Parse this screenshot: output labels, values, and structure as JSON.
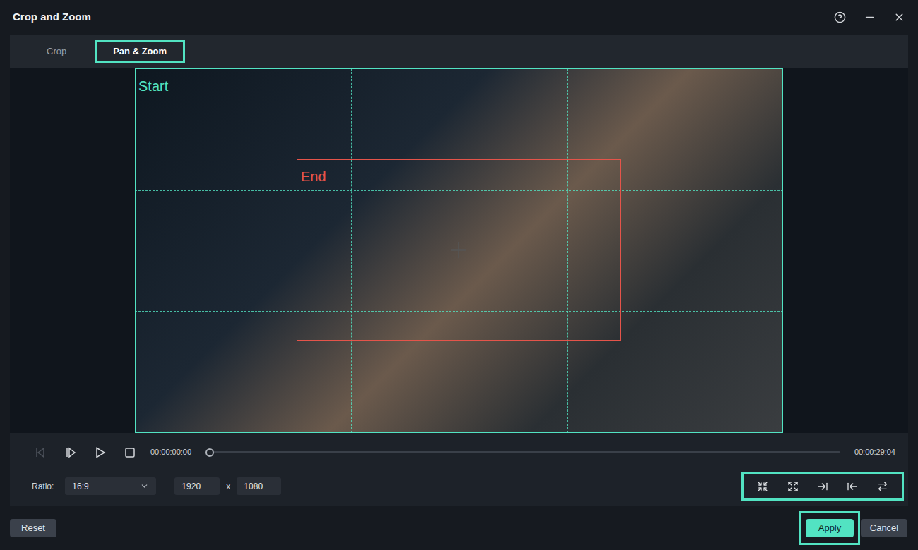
{
  "window": {
    "title": "Crop and Zoom"
  },
  "tabs": [
    {
      "label": "Crop",
      "selected": false,
      "highlighted": false
    },
    {
      "label": "Pan & Zoom",
      "selected": true,
      "highlighted": true
    }
  ],
  "preview": {
    "start_label": "Start",
    "end_label": "End"
  },
  "playback": {
    "current_time": "00:00:00:00",
    "duration": "00:00:29:04",
    "level": 0,
    "prev_disabled": true
  },
  "ratio": {
    "label": "Ratio:",
    "value": "16:9",
    "width": "1920",
    "separator": "x",
    "height": "1080"
  },
  "pan_tools": {
    "highlighted": true
  },
  "buttons": [
    {
      "label": "Reset",
      "primary": false,
      "highlighted": false
    },
    {
      "label": "Apply",
      "primary": true,
      "highlighted": true
    },
    {
      "label": "Cancel",
      "primary": false,
      "highlighted": false
    }
  ]
}
